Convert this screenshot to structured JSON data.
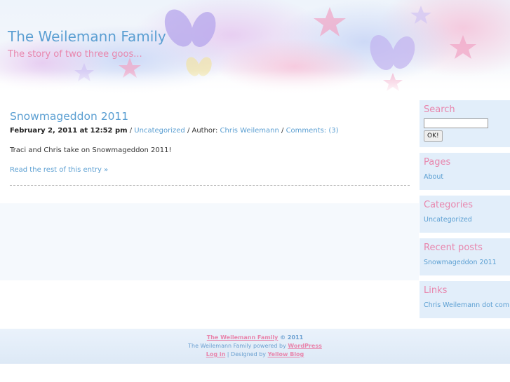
{
  "site": {
    "title": "The Weilemann Family",
    "tagline": "The story of two three goos..."
  },
  "post": {
    "title": "Snowmageddon 2011",
    "date": "February 2, 2011 at 12:52 pm",
    "sep1": " / ",
    "category": "Uncategorized",
    "author_prefix": " / Author: ",
    "author": "Chris Weilemann",
    "sep2": " / ",
    "comments": "Comments: (3)",
    "body": "Traci and Chris take on Snowmageddon 2011!",
    "more": "Read the rest of this entry »"
  },
  "sidebar": {
    "search": {
      "title": "Search",
      "value": "",
      "button": "OK!"
    },
    "pages": {
      "title": "Pages",
      "items": [
        "About"
      ]
    },
    "categories": {
      "title": "Categories",
      "items": [
        "Uncategorized"
      ]
    },
    "recent": {
      "title": "Recent posts",
      "items": [
        "Snowmageddon 2011"
      ]
    },
    "links": {
      "title": "Links",
      "items": [
        "Chris Weilemann dot com"
      ]
    }
  },
  "footer": {
    "site_link": "The Weilemann Family",
    "copyright": " © 2011",
    "powered_prefix": "The Weilemann Family powered by ",
    "wordpress": "WordPress",
    "login": "Log in",
    "designed_prefix": " | Designed by ",
    "designer": "Yellow Blog"
  },
  "colors": {
    "accent_blue": "#5b9fd2",
    "accent_pink": "#e886ad",
    "sidebar_bg": "#e2eefa"
  }
}
